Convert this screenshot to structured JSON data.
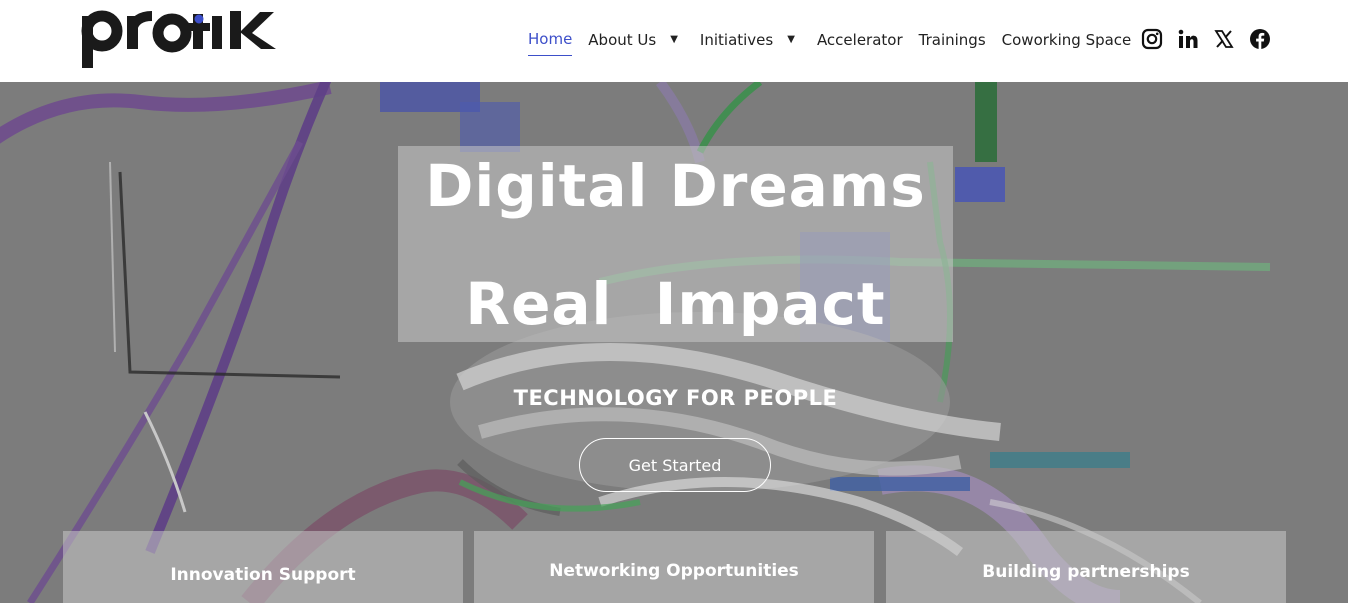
{
  "brand": {
    "logo_text": "protik",
    "accent": "#3d4fc9"
  },
  "nav": {
    "items": [
      {
        "label": "Home",
        "active": true,
        "has_dropdown": false
      },
      {
        "label": "About Us",
        "active": false,
        "has_dropdown": true
      },
      {
        "label": "Initiatives",
        "active": false,
        "has_dropdown": true
      },
      {
        "label": "Accelerator",
        "active": false,
        "has_dropdown": false
      },
      {
        "label": "Trainings",
        "active": false,
        "has_dropdown": false
      },
      {
        "label": "Coworking Space",
        "active": false,
        "has_dropdown": false
      }
    ],
    "social_icons": [
      "instagram-icon",
      "linkedin-icon",
      "x-icon",
      "facebook-icon"
    ]
  },
  "hero": {
    "headline_line1": "Digital Dreams",
    "headline_line2": "Real  Impact",
    "tagline": "TECHNOLOGY FOR PEOPLE",
    "cta_label": "Get Started"
  },
  "features": [
    {
      "title": "Innovation Support"
    },
    {
      "title": "Networking Opportunities"
    },
    {
      "title": "Building partnerships"
    }
  ]
}
